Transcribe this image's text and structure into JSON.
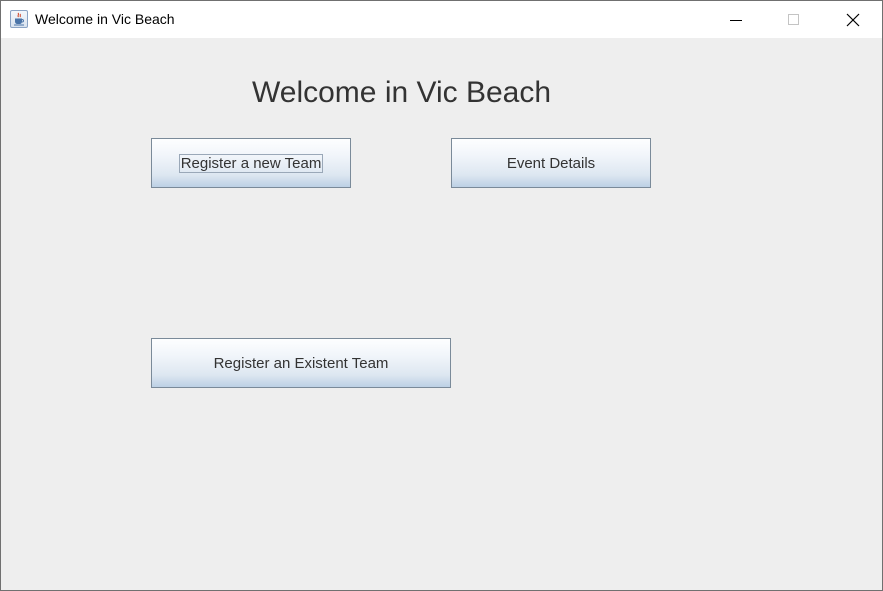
{
  "window": {
    "title": "Welcome in Vic Beach",
    "app_icon": "java-cup-icon"
  },
  "main": {
    "heading": "Welcome in Vic Beach",
    "buttons": {
      "register_new_team": "Register a new Team",
      "event_details": "Event Details",
      "register_existent_team": "Register an Existent Team"
    },
    "focused_button": "register_new_team"
  },
  "colors": {
    "window_background": "#eeeeee",
    "titlebar_background": "#ffffff",
    "button_border": "#7a8a99",
    "button_text": "#333333"
  }
}
